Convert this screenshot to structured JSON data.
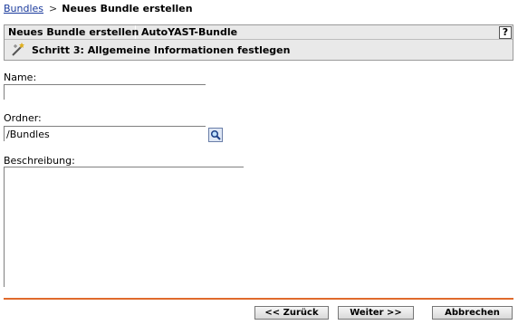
{
  "breadcrumb": {
    "root": "Bundles",
    "current": "Neues Bundle erstellen"
  },
  "header": {
    "col1": "Neues Bundle erstellen",
    "col2": "AutoYAST-Bundle",
    "help": "?",
    "step": "Schritt 3: Allgemeine Informationen festlegen"
  },
  "form": {
    "name_label": "Name:",
    "name_value": "",
    "folder_label": "Ordner:",
    "folder_value": "/Bundles",
    "description_label": "Beschreibung:",
    "description_value": ""
  },
  "buttons": {
    "back": "<< Zurück",
    "next": "Weiter >>",
    "cancel": "Abbrechen"
  },
  "icons": {
    "step": "wizard-wand-icon",
    "browse": "magnifier-icon"
  },
  "colors": {
    "divider": "#e06a2c",
    "link": "#1a3a9c",
    "header_bg": "#e9e9e9"
  }
}
